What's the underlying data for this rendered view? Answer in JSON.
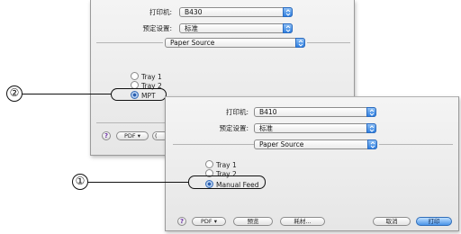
{
  "dialog_back": {
    "printer_label": "打印机:",
    "printer_value": "B430",
    "presets_label": "预定设置:",
    "presets_value": "标准",
    "section_value": "Paper Source",
    "options": [
      {
        "label": "Tray 1",
        "selected": false
      },
      {
        "label": "Tray 2",
        "selected": false
      },
      {
        "label": "MPT",
        "selected": true
      }
    ],
    "help_label": "?",
    "pdf_label": "PDF ▾",
    "partial_button_label": "("
  },
  "dialog_front": {
    "printer_label": "打印机:",
    "printer_value": "B410",
    "presets_label": "预定设置:",
    "presets_value": "标准",
    "section_value": "Paper Source",
    "options": [
      {
        "label": "Tray 1",
        "selected": false
      },
      {
        "label": "Tray 2",
        "selected": false
      },
      {
        "label": "Manual Feed",
        "selected": true
      }
    ],
    "help_label": "?",
    "pdf_label": "PDF ▾",
    "preview_label": "预览",
    "supplies_label": "耗材...",
    "cancel_label": "取消",
    "print_label": "打印"
  },
  "callouts": {
    "back": "②",
    "front": "①"
  },
  "colors": {
    "accent": "#2f7fe0",
    "dialog_bg": "#ececec"
  }
}
